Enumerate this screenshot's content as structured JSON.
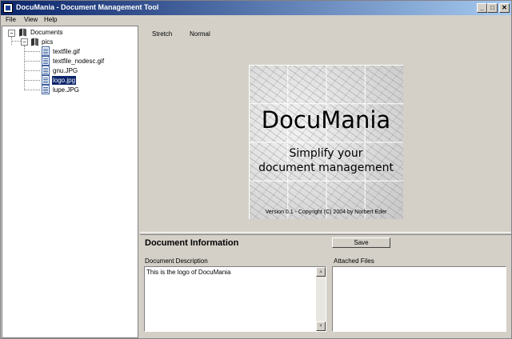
{
  "window": {
    "title": "DocuMania - Document Management Tool",
    "controls": {
      "minimize": "_",
      "maximize": "□",
      "close": "✕"
    }
  },
  "menu": {
    "file": "File",
    "view": "View",
    "help": "Help"
  },
  "tree": {
    "root": {
      "label": "Documents",
      "expander": "−",
      "icon": "book-icon"
    },
    "folder": {
      "label": "pics",
      "expander": "−",
      "icon": "book-icon"
    },
    "files": [
      {
        "label": "textfile.gif",
        "icon": "file-icon"
      },
      {
        "label": "textfile_nodesc.gif",
        "icon": "file-icon"
      },
      {
        "label": "gnu.JPG",
        "icon": "file-icon"
      },
      {
        "label": "logo.jpg",
        "icon": "file-icon",
        "selected": true
      },
      {
        "label": "lupe.JPG",
        "icon": "file-icon"
      }
    ]
  },
  "viewer": {
    "tabs": {
      "stretch": "Stretch",
      "normal": "Normal"
    },
    "logo": {
      "title": "DocuMania",
      "tagline_line1": "Simplify your",
      "tagline_line2": "document management",
      "copyright": "Version 0.1 - Copyright (C) 2004 by Norbert Eder"
    }
  },
  "info": {
    "heading": "Document Information",
    "save_label": "Save",
    "description_label": "Document Description",
    "description_value": "This is the logo of DocuMania",
    "attached_files_label": "Attached Files"
  },
  "colors": {
    "titlebar_start": "#0a246a",
    "titlebar_end": "#a6caf0",
    "window_bg": "#d4d0c8",
    "selection": "#0a246a"
  }
}
